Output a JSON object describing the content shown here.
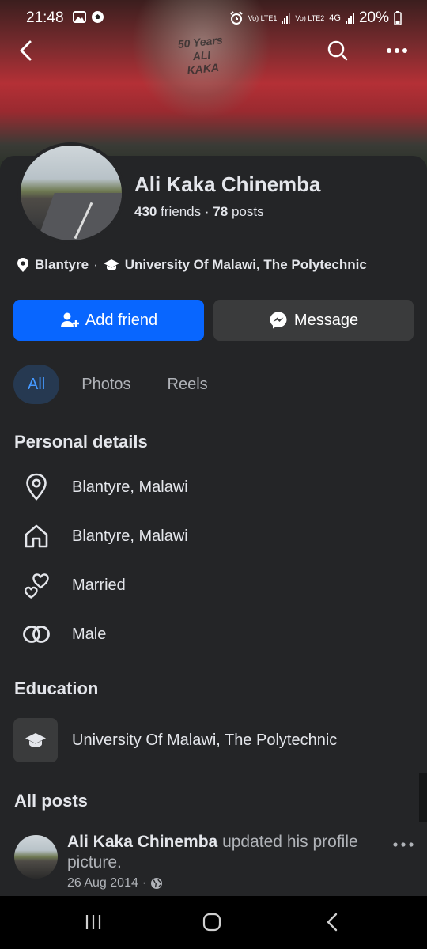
{
  "status_bar": {
    "time": "21:48",
    "lte1_label": "Vo) LTE1",
    "lte2_label": "Vo) LTE2",
    "network_label": "4G",
    "battery": "20%"
  },
  "cover": {
    "badge_lines": [
      "50 Years",
      "ALI",
      "KAKA"
    ]
  },
  "profile": {
    "name": "Ali Kaka Chinemba",
    "friends_count": "430",
    "friends_label": "friends",
    "separator": "·",
    "posts_count": "78",
    "posts_label": "posts",
    "location": "Blantyre",
    "school": "University Of Malawi, The Polytechnic"
  },
  "actions": {
    "add_friend": "Add friend",
    "message": "Message"
  },
  "tabs": [
    {
      "label": "All",
      "active": true
    },
    {
      "label": "Photos",
      "active": false
    },
    {
      "label": "Reels",
      "active": false
    }
  ],
  "personal_details": {
    "title": "Personal details",
    "items": [
      {
        "icon": "location-pin-icon",
        "text": "Blantyre, Malawi"
      },
      {
        "icon": "home-icon",
        "text": "Blantyre, Malawi"
      },
      {
        "icon": "hearts-icon",
        "text": "Married"
      },
      {
        "icon": "gender-icon",
        "text": "Male"
      }
    ]
  },
  "education": {
    "title": "Education",
    "school": "University Of Malawi, The Polytechnic"
  },
  "all_posts": {
    "title": "All posts",
    "post": {
      "author": "Ali Kaka Chinemba",
      "action": " updated his profile picture.",
      "date": "26 Aug 2014",
      "date_separator": "·"
    }
  },
  "colors": {
    "background": "#242527",
    "primary_button": "#0866ff",
    "secondary_button": "#3a3b3c",
    "active_tab_bg": "#263951",
    "active_tab_text": "#4599ff"
  }
}
